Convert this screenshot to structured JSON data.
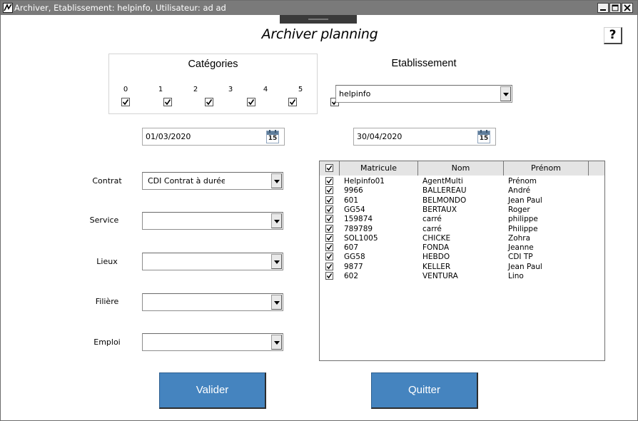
{
  "window": {
    "title": "Archiver, Etablissement: helpinfo, Utilisateur: ad ad",
    "icon": "app-icon",
    "controls": [
      "minimize-icon",
      "maximize-icon",
      "close-icon"
    ]
  },
  "page": {
    "title": "Archiver planning",
    "help_label": "?"
  },
  "categories": {
    "title": "Catégories",
    "items": [
      {
        "label": "0",
        "checked": true
      },
      {
        "label": "1",
        "checked": true
      },
      {
        "label": "2",
        "checked": true
      },
      {
        "label": "3",
        "checked": true
      },
      {
        "label": "4",
        "checked": true
      },
      {
        "label": "5",
        "checked": true
      }
    ]
  },
  "etablissement": {
    "title": "Etablissement",
    "selected": "helpinfo"
  },
  "dates": {
    "start": "01/03/2020",
    "end": "30/04/2020",
    "calendar_day": "15"
  },
  "filters": {
    "contrat": {
      "label": "Contrat",
      "value": "CDI Contrat à durée i"
    },
    "service": {
      "label": "Service",
      "value": ""
    },
    "lieux": {
      "label": "Lieux",
      "value": ""
    },
    "filiere": {
      "label": "Filière",
      "value": ""
    },
    "emploi": {
      "label": "Emploi",
      "value": ""
    }
  },
  "grid": {
    "columns": [
      "Matricule",
      "Nom",
      "Prénom"
    ],
    "rows": [
      {
        "matricule": "Helpinfo01",
        "nom": "AgentMulti",
        "prenom": "Prénom",
        "checked": true
      },
      {
        "matricule": "9966",
        "nom": "BALLEREAU",
        "prenom": "André",
        "checked": true
      },
      {
        "matricule": "601",
        "nom": "BELMONDO",
        "prenom": "Jean Paul",
        "checked": true
      },
      {
        "matricule": "GG54",
        "nom": "BERTAUX",
        "prenom": "Roger",
        "checked": true
      },
      {
        "matricule": "159874",
        "nom": "carré",
        "prenom": "philippe",
        "checked": true
      },
      {
        "matricule": "789789",
        "nom": "carré",
        "prenom": "Philippe",
        "checked": true
      },
      {
        "matricule": "SOL1005",
        "nom": "CHICKE",
        "prenom": "Zohra",
        "checked": true
      },
      {
        "matricule": "607",
        "nom": "FONDA",
        "prenom": "Jeanne",
        "checked": true
      },
      {
        "matricule": "GG58",
        "nom": "HEBDO",
        "prenom": "CDI TP",
        "checked": true
      },
      {
        "matricule": "9877",
        "nom": "KELLER",
        "prenom": "Jean Paul",
        "checked": true
      },
      {
        "matricule": "602",
        "nom": "VENTURA",
        "prenom": "Lino",
        "checked": true
      }
    ]
  },
  "buttons": {
    "validate": "Valider",
    "quit": "Quitter"
  },
  "colors": {
    "titlebar": "#7a7a7a",
    "button": "#4584bf"
  }
}
